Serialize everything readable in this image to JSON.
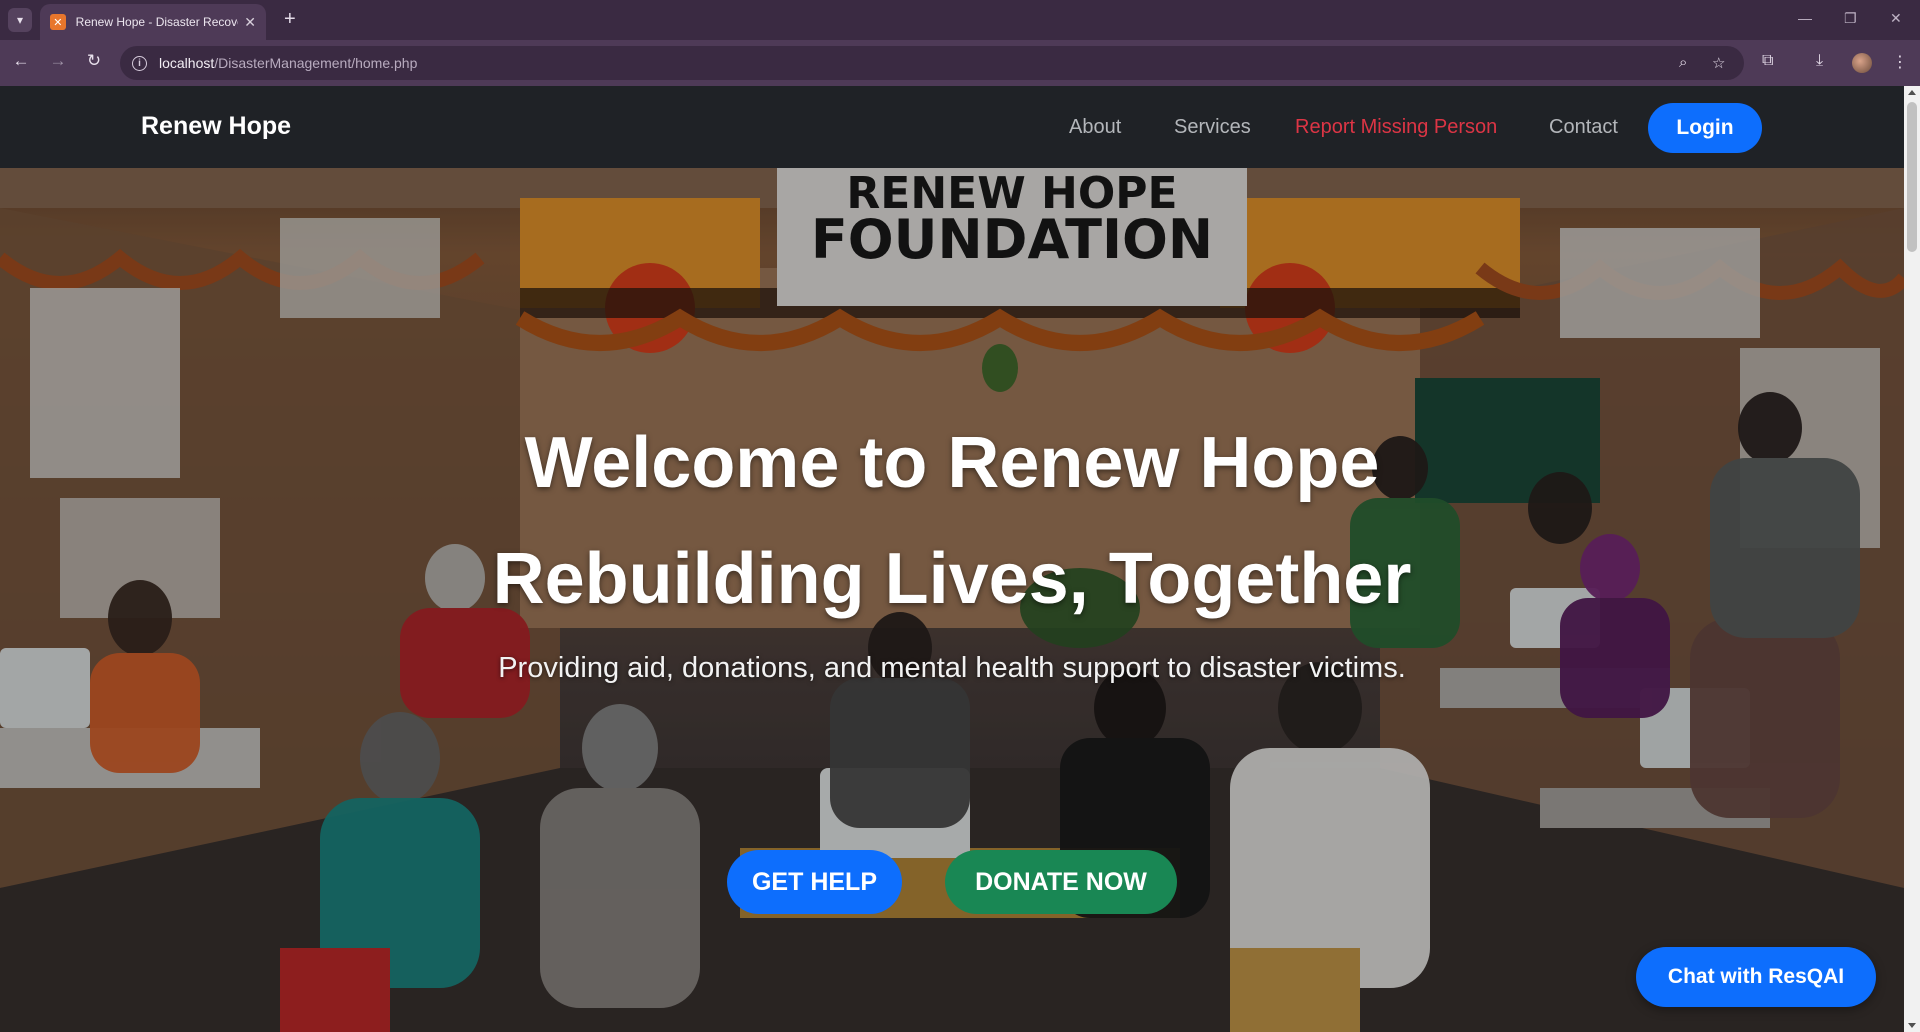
{
  "browser": {
    "tab_title": "Renew Hope - Disaster Recovery",
    "tab_favicon": "xampp-icon",
    "url_host": "localhost",
    "url_path": "/DisasterManagement/home.php",
    "icons": [
      "tab-list-icon",
      "close-icon",
      "new-tab-icon",
      "back-icon",
      "forward-icon",
      "reload-icon",
      "info-icon",
      "zoom-icon",
      "star-icon",
      "extensions-icon",
      "download-icon",
      "profile-avatar",
      "menu-icon",
      "minimize-icon",
      "restore-icon",
      "window-close-icon"
    ]
  },
  "site": {
    "brand": "Renew Hope",
    "nav": {
      "about": "About",
      "services": "Services",
      "report": "Report Missing Person",
      "contact": "Contact",
      "login": "Login"
    }
  },
  "hero": {
    "title_line1": "Welcome to Renew Hope",
    "title_line2": "Rebuilding Lives, Together",
    "subtitle": "Providing aid, donations, and mental health support to disaster victims.",
    "banner_line1": "RENEW HOPE",
    "banner_line2": "FOUNDATION",
    "get_help": "GET HELP",
    "donate_now": "DONATE NOW"
  },
  "chat": {
    "label": "Chat with ResQAI"
  },
  "colors": {
    "primary": "#0d6efd",
    "success": "#198754",
    "danger": "#dc3545",
    "navbar": "#1f2226",
    "browser_chrome": "#4e3a57"
  }
}
